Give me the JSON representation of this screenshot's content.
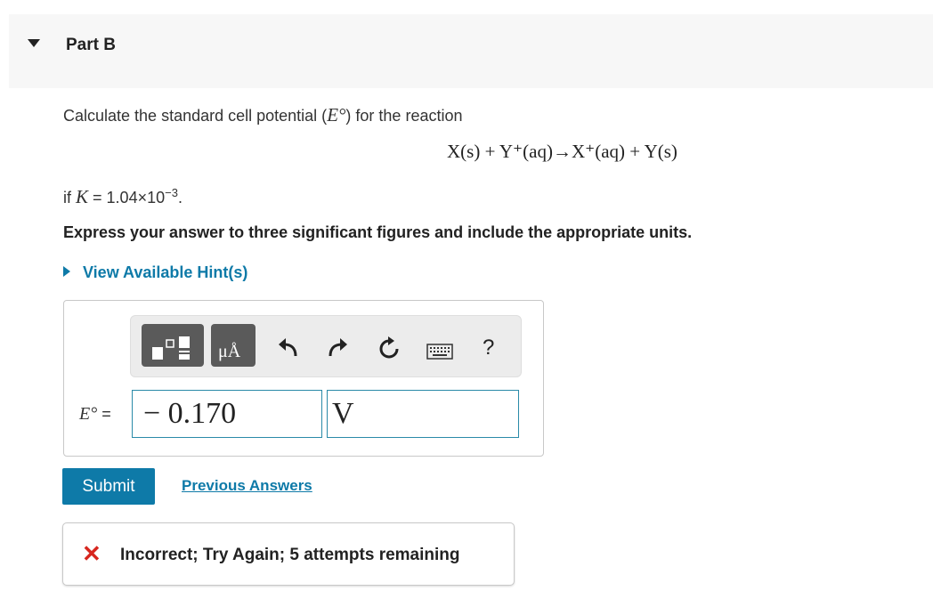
{
  "part": {
    "title": "Part B"
  },
  "question": {
    "text_before": "Calculate the standard cell potential (",
    "symbol": "E°",
    "text_after": ") for the reaction",
    "equation": "X(s) + Y⁺(aq)→X⁺(aq) + Y(s)",
    "if_prefix": "if ",
    "k_symbol": "K",
    "k_equals": " = 1.04×10",
    "k_exponent": "−3",
    "k_period": ".",
    "instructions": "Express your answer to three significant figures and include the appropriate units."
  },
  "hint": {
    "label": "View Available Hint(s)"
  },
  "toolbar": {
    "units_button_label": "μÅ",
    "help_label": "?"
  },
  "answer": {
    "label_symbol": "E°",
    "label_equals": " =",
    "value": "− 0.170",
    "unit": "V"
  },
  "actions": {
    "submit_label": "Submit",
    "previous_answers_label": "Previous Answers"
  },
  "feedback": {
    "icon": "✕",
    "message": "Incorrect; Try Again; 5 attempts remaining",
    "color": "#d7261e"
  },
  "colors": {
    "accent": "#0e7aa8",
    "header_bg": "#f7f7f7",
    "toolbar_bg": "#ececec"
  }
}
